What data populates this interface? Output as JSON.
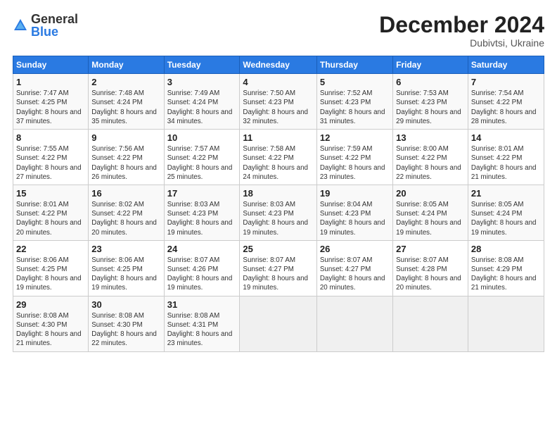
{
  "logo": {
    "general": "General",
    "blue": "Blue"
  },
  "header": {
    "month": "December 2024",
    "location": "Dubivtsi, Ukraine"
  },
  "weekdays": [
    "Sunday",
    "Monday",
    "Tuesday",
    "Wednesday",
    "Thursday",
    "Friday",
    "Saturday"
  ],
  "weeks": [
    [
      {
        "day": "1",
        "rise": "7:47 AM",
        "set": "4:25 PM",
        "daylight": "8 hours and 37 minutes."
      },
      {
        "day": "2",
        "rise": "7:48 AM",
        "set": "4:24 PM",
        "daylight": "8 hours and 35 minutes."
      },
      {
        "day": "3",
        "rise": "7:49 AM",
        "set": "4:24 PM",
        "daylight": "8 hours and 34 minutes."
      },
      {
        "day": "4",
        "rise": "7:50 AM",
        "set": "4:23 PM",
        "daylight": "8 hours and 32 minutes."
      },
      {
        "day": "5",
        "rise": "7:52 AM",
        "set": "4:23 PM",
        "daylight": "8 hours and 31 minutes."
      },
      {
        "day": "6",
        "rise": "7:53 AM",
        "set": "4:23 PM",
        "daylight": "8 hours and 29 minutes."
      },
      {
        "day": "7",
        "rise": "7:54 AM",
        "set": "4:22 PM",
        "daylight": "8 hours and 28 minutes."
      }
    ],
    [
      {
        "day": "8",
        "rise": "7:55 AM",
        "set": "4:22 PM",
        "daylight": "8 hours and 27 minutes."
      },
      {
        "day": "9",
        "rise": "7:56 AM",
        "set": "4:22 PM",
        "daylight": "8 hours and 26 minutes."
      },
      {
        "day": "10",
        "rise": "7:57 AM",
        "set": "4:22 PM",
        "daylight": "8 hours and 25 minutes."
      },
      {
        "day": "11",
        "rise": "7:58 AM",
        "set": "4:22 PM",
        "daylight": "8 hours and 24 minutes."
      },
      {
        "day": "12",
        "rise": "7:59 AM",
        "set": "4:22 PM",
        "daylight": "8 hours and 23 minutes."
      },
      {
        "day": "13",
        "rise": "8:00 AM",
        "set": "4:22 PM",
        "daylight": "8 hours and 22 minutes."
      },
      {
        "day": "14",
        "rise": "8:01 AM",
        "set": "4:22 PM",
        "daylight": "8 hours and 21 minutes."
      }
    ],
    [
      {
        "day": "15",
        "rise": "8:01 AM",
        "set": "4:22 PM",
        "daylight": "8 hours and 20 minutes."
      },
      {
        "day": "16",
        "rise": "8:02 AM",
        "set": "4:22 PM",
        "daylight": "8 hours and 20 minutes."
      },
      {
        "day": "17",
        "rise": "8:03 AM",
        "set": "4:23 PM",
        "daylight": "8 hours and 19 minutes."
      },
      {
        "day": "18",
        "rise": "8:03 AM",
        "set": "4:23 PM",
        "daylight": "8 hours and 19 minutes."
      },
      {
        "day": "19",
        "rise": "8:04 AM",
        "set": "4:23 PM",
        "daylight": "8 hours and 19 minutes."
      },
      {
        "day": "20",
        "rise": "8:05 AM",
        "set": "4:24 PM",
        "daylight": "8 hours and 19 minutes."
      },
      {
        "day": "21",
        "rise": "8:05 AM",
        "set": "4:24 PM",
        "daylight": "8 hours and 19 minutes."
      }
    ],
    [
      {
        "day": "22",
        "rise": "8:06 AM",
        "set": "4:25 PM",
        "daylight": "8 hours and 19 minutes."
      },
      {
        "day": "23",
        "rise": "8:06 AM",
        "set": "4:25 PM",
        "daylight": "8 hours and 19 minutes."
      },
      {
        "day": "24",
        "rise": "8:07 AM",
        "set": "4:26 PM",
        "daylight": "8 hours and 19 minutes."
      },
      {
        "day": "25",
        "rise": "8:07 AM",
        "set": "4:27 PM",
        "daylight": "8 hours and 19 minutes."
      },
      {
        "day": "26",
        "rise": "8:07 AM",
        "set": "4:27 PM",
        "daylight": "8 hours and 20 minutes."
      },
      {
        "day": "27",
        "rise": "8:07 AM",
        "set": "4:28 PM",
        "daylight": "8 hours and 20 minutes."
      },
      {
        "day": "28",
        "rise": "8:08 AM",
        "set": "4:29 PM",
        "daylight": "8 hours and 21 minutes."
      }
    ],
    [
      {
        "day": "29",
        "rise": "8:08 AM",
        "set": "4:30 PM",
        "daylight": "8 hours and 21 minutes."
      },
      {
        "day": "30",
        "rise": "8:08 AM",
        "set": "4:30 PM",
        "daylight": "8 hours and 22 minutes."
      },
      {
        "day": "31",
        "rise": "8:08 AM",
        "set": "4:31 PM",
        "daylight": "8 hours and 23 minutes."
      },
      null,
      null,
      null,
      null
    ]
  ]
}
